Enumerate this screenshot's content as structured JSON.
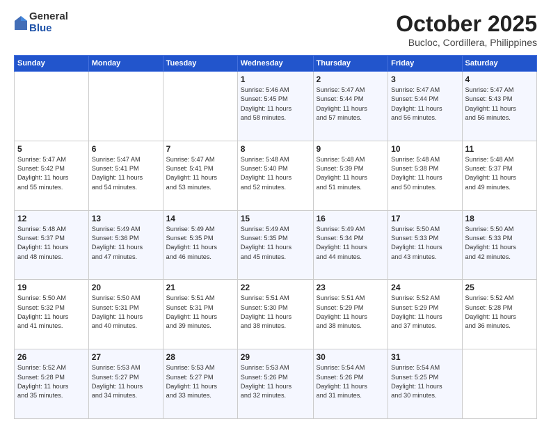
{
  "logo": {
    "general": "General",
    "blue": "Blue"
  },
  "header": {
    "month": "October 2025",
    "location": "Bucloc, Cordillera, Philippines"
  },
  "weekdays": [
    "Sunday",
    "Monday",
    "Tuesday",
    "Wednesday",
    "Thursday",
    "Friday",
    "Saturday"
  ],
  "weeks": [
    [
      {
        "day": "",
        "info": ""
      },
      {
        "day": "",
        "info": ""
      },
      {
        "day": "",
        "info": ""
      },
      {
        "day": "1",
        "info": "Sunrise: 5:46 AM\nSunset: 5:45 PM\nDaylight: 11 hours\nand 58 minutes."
      },
      {
        "day": "2",
        "info": "Sunrise: 5:47 AM\nSunset: 5:44 PM\nDaylight: 11 hours\nand 57 minutes."
      },
      {
        "day": "3",
        "info": "Sunrise: 5:47 AM\nSunset: 5:44 PM\nDaylight: 11 hours\nand 56 minutes."
      },
      {
        "day": "4",
        "info": "Sunrise: 5:47 AM\nSunset: 5:43 PM\nDaylight: 11 hours\nand 56 minutes."
      }
    ],
    [
      {
        "day": "5",
        "info": "Sunrise: 5:47 AM\nSunset: 5:42 PM\nDaylight: 11 hours\nand 55 minutes."
      },
      {
        "day": "6",
        "info": "Sunrise: 5:47 AM\nSunset: 5:41 PM\nDaylight: 11 hours\nand 54 minutes."
      },
      {
        "day": "7",
        "info": "Sunrise: 5:47 AM\nSunset: 5:41 PM\nDaylight: 11 hours\nand 53 minutes."
      },
      {
        "day": "8",
        "info": "Sunrise: 5:48 AM\nSunset: 5:40 PM\nDaylight: 11 hours\nand 52 minutes."
      },
      {
        "day": "9",
        "info": "Sunrise: 5:48 AM\nSunset: 5:39 PM\nDaylight: 11 hours\nand 51 minutes."
      },
      {
        "day": "10",
        "info": "Sunrise: 5:48 AM\nSunset: 5:38 PM\nDaylight: 11 hours\nand 50 minutes."
      },
      {
        "day": "11",
        "info": "Sunrise: 5:48 AM\nSunset: 5:37 PM\nDaylight: 11 hours\nand 49 minutes."
      }
    ],
    [
      {
        "day": "12",
        "info": "Sunrise: 5:48 AM\nSunset: 5:37 PM\nDaylight: 11 hours\nand 48 minutes."
      },
      {
        "day": "13",
        "info": "Sunrise: 5:49 AM\nSunset: 5:36 PM\nDaylight: 11 hours\nand 47 minutes."
      },
      {
        "day": "14",
        "info": "Sunrise: 5:49 AM\nSunset: 5:35 PM\nDaylight: 11 hours\nand 46 minutes."
      },
      {
        "day": "15",
        "info": "Sunrise: 5:49 AM\nSunset: 5:35 PM\nDaylight: 11 hours\nand 45 minutes."
      },
      {
        "day": "16",
        "info": "Sunrise: 5:49 AM\nSunset: 5:34 PM\nDaylight: 11 hours\nand 44 minutes."
      },
      {
        "day": "17",
        "info": "Sunrise: 5:50 AM\nSunset: 5:33 PM\nDaylight: 11 hours\nand 43 minutes."
      },
      {
        "day": "18",
        "info": "Sunrise: 5:50 AM\nSunset: 5:33 PM\nDaylight: 11 hours\nand 42 minutes."
      }
    ],
    [
      {
        "day": "19",
        "info": "Sunrise: 5:50 AM\nSunset: 5:32 PM\nDaylight: 11 hours\nand 41 minutes."
      },
      {
        "day": "20",
        "info": "Sunrise: 5:50 AM\nSunset: 5:31 PM\nDaylight: 11 hours\nand 40 minutes."
      },
      {
        "day": "21",
        "info": "Sunrise: 5:51 AM\nSunset: 5:31 PM\nDaylight: 11 hours\nand 39 minutes."
      },
      {
        "day": "22",
        "info": "Sunrise: 5:51 AM\nSunset: 5:30 PM\nDaylight: 11 hours\nand 38 minutes."
      },
      {
        "day": "23",
        "info": "Sunrise: 5:51 AM\nSunset: 5:29 PM\nDaylight: 11 hours\nand 38 minutes."
      },
      {
        "day": "24",
        "info": "Sunrise: 5:52 AM\nSunset: 5:29 PM\nDaylight: 11 hours\nand 37 minutes."
      },
      {
        "day": "25",
        "info": "Sunrise: 5:52 AM\nSunset: 5:28 PM\nDaylight: 11 hours\nand 36 minutes."
      }
    ],
    [
      {
        "day": "26",
        "info": "Sunrise: 5:52 AM\nSunset: 5:28 PM\nDaylight: 11 hours\nand 35 minutes."
      },
      {
        "day": "27",
        "info": "Sunrise: 5:53 AM\nSunset: 5:27 PM\nDaylight: 11 hours\nand 34 minutes."
      },
      {
        "day": "28",
        "info": "Sunrise: 5:53 AM\nSunset: 5:27 PM\nDaylight: 11 hours\nand 33 minutes."
      },
      {
        "day": "29",
        "info": "Sunrise: 5:53 AM\nSunset: 5:26 PM\nDaylight: 11 hours\nand 32 minutes."
      },
      {
        "day": "30",
        "info": "Sunrise: 5:54 AM\nSunset: 5:26 PM\nDaylight: 11 hours\nand 31 minutes."
      },
      {
        "day": "31",
        "info": "Sunrise: 5:54 AM\nSunset: 5:25 PM\nDaylight: 11 hours\nand 30 minutes."
      },
      {
        "day": "",
        "info": ""
      }
    ]
  ]
}
